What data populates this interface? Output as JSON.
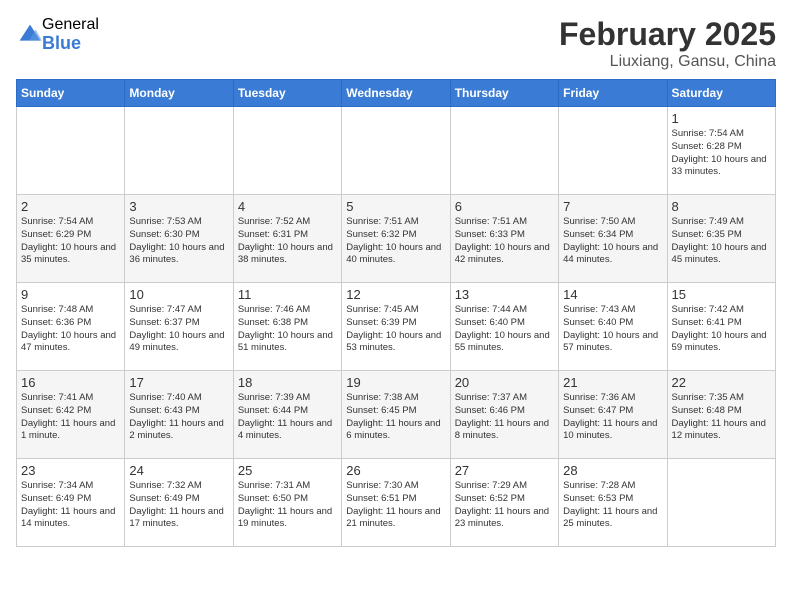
{
  "header": {
    "logo_general": "General",
    "logo_blue": "Blue",
    "month_title": "February 2025",
    "location": "Liuxiang, Gansu, China"
  },
  "days_of_week": [
    "Sunday",
    "Monday",
    "Tuesday",
    "Wednesday",
    "Thursday",
    "Friday",
    "Saturday"
  ],
  "weeks": [
    [
      {
        "day": "",
        "info": ""
      },
      {
        "day": "",
        "info": ""
      },
      {
        "day": "",
        "info": ""
      },
      {
        "day": "",
        "info": ""
      },
      {
        "day": "",
        "info": ""
      },
      {
        "day": "",
        "info": ""
      },
      {
        "day": "1",
        "info": "Sunrise: 7:54 AM\nSunset: 6:28 PM\nDaylight: 10 hours and 33 minutes."
      }
    ],
    [
      {
        "day": "2",
        "info": "Sunrise: 7:54 AM\nSunset: 6:29 PM\nDaylight: 10 hours and 35 minutes."
      },
      {
        "day": "3",
        "info": "Sunrise: 7:53 AM\nSunset: 6:30 PM\nDaylight: 10 hours and 36 minutes."
      },
      {
        "day": "4",
        "info": "Sunrise: 7:52 AM\nSunset: 6:31 PM\nDaylight: 10 hours and 38 minutes."
      },
      {
        "day": "5",
        "info": "Sunrise: 7:51 AM\nSunset: 6:32 PM\nDaylight: 10 hours and 40 minutes."
      },
      {
        "day": "6",
        "info": "Sunrise: 7:51 AM\nSunset: 6:33 PM\nDaylight: 10 hours and 42 minutes."
      },
      {
        "day": "7",
        "info": "Sunrise: 7:50 AM\nSunset: 6:34 PM\nDaylight: 10 hours and 44 minutes."
      },
      {
        "day": "8",
        "info": "Sunrise: 7:49 AM\nSunset: 6:35 PM\nDaylight: 10 hours and 45 minutes."
      }
    ],
    [
      {
        "day": "9",
        "info": "Sunrise: 7:48 AM\nSunset: 6:36 PM\nDaylight: 10 hours and 47 minutes."
      },
      {
        "day": "10",
        "info": "Sunrise: 7:47 AM\nSunset: 6:37 PM\nDaylight: 10 hours and 49 minutes."
      },
      {
        "day": "11",
        "info": "Sunrise: 7:46 AM\nSunset: 6:38 PM\nDaylight: 10 hours and 51 minutes."
      },
      {
        "day": "12",
        "info": "Sunrise: 7:45 AM\nSunset: 6:39 PM\nDaylight: 10 hours and 53 minutes."
      },
      {
        "day": "13",
        "info": "Sunrise: 7:44 AM\nSunset: 6:40 PM\nDaylight: 10 hours and 55 minutes."
      },
      {
        "day": "14",
        "info": "Sunrise: 7:43 AM\nSunset: 6:40 PM\nDaylight: 10 hours and 57 minutes."
      },
      {
        "day": "15",
        "info": "Sunrise: 7:42 AM\nSunset: 6:41 PM\nDaylight: 10 hours and 59 minutes."
      }
    ],
    [
      {
        "day": "16",
        "info": "Sunrise: 7:41 AM\nSunset: 6:42 PM\nDaylight: 11 hours and 1 minute."
      },
      {
        "day": "17",
        "info": "Sunrise: 7:40 AM\nSunset: 6:43 PM\nDaylight: 11 hours and 2 minutes."
      },
      {
        "day": "18",
        "info": "Sunrise: 7:39 AM\nSunset: 6:44 PM\nDaylight: 11 hours and 4 minutes."
      },
      {
        "day": "19",
        "info": "Sunrise: 7:38 AM\nSunset: 6:45 PM\nDaylight: 11 hours and 6 minutes."
      },
      {
        "day": "20",
        "info": "Sunrise: 7:37 AM\nSunset: 6:46 PM\nDaylight: 11 hours and 8 minutes."
      },
      {
        "day": "21",
        "info": "Sunrise: 7:36 AM\nSunset: 6:47 PM\nDaylight: 11 hours and 10 minutes."
      },
      {
        "day": "22",
        "info": "Sunrise: 7:35 AM\nSunset: 6:48 PM\nDaylight: 11 hours and 12 minutes."
      }
    ],
    [
      {
        "day": "23",
        "info": "Sunrise: 7:34 AM\nSunset: 6:49 PM\nDaylight: 11 hours and 14 minutes."
      },
      {
        "day": "24",
        "info": "Sunrise: 7:32 AM\nSunset: 6:49 PM\nDaylight: 11 hours and 17 minutes."
      },
      {
        "day": "25",
        "info": "Sunrise: 7:31 AM\nSunset: 6:50 PM\nDaylight: 11 hours and 19 minutes."
      },
      {
        "day": "26",
        "info": "Sunrise: 7:30 AM\nSunset: 6:51 PM\nDaylight: 11 hours and 21 minutes."
      },
      {
        "day": "27",
        "info": "Sunrise: 7:29 AM\nSunset: 6:52 PM\nDaylight: 11 hours and 23 minutes."
      },
      {
        "day": "28",
        "info": "Sunrise: 7:28 AM\nSunset: 6:53 PM\nDaylight: 11 hours and 25 minutes."
      },
      {
        "day": "",
        "info": ""
      }
    ]
  ]
}
